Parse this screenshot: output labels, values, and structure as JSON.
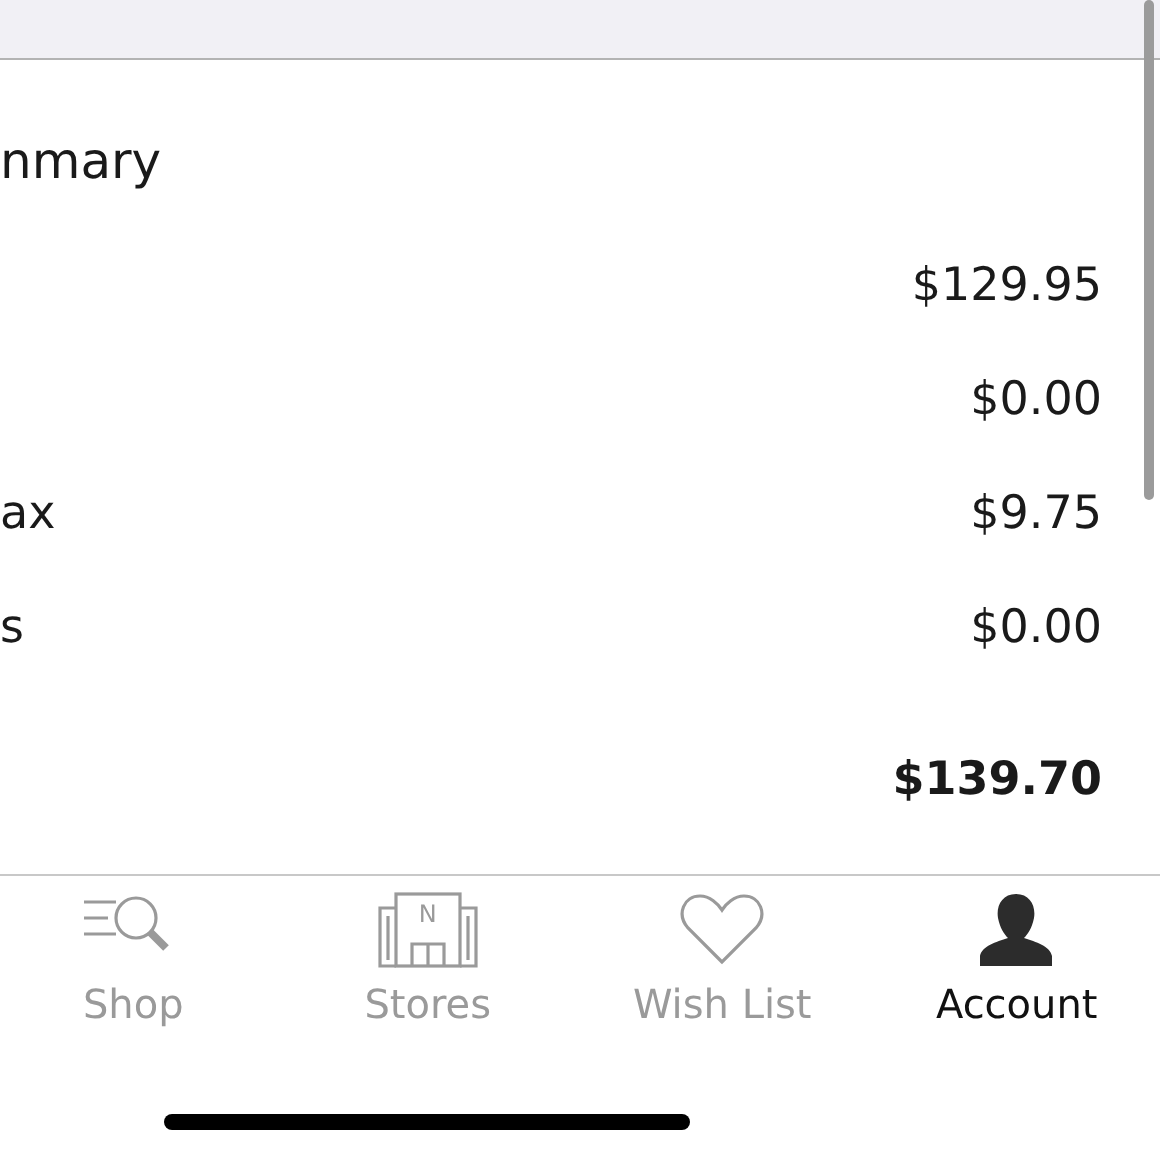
{
  "summary": {
    "title": "nmary",
    "rows": [
      {
        "label": "",
        "value": "$129.95",
        "bold": false
      },
      {
        "label": "",
        "value": "$0.00",
        "bold": false
      },
      {
        "label": "ax",
        "value": "$9.75",
        "bold": false
      },
      {
        "label": "s",
        "value": "$0.00",
        "bold": false
      },
      {
        "label": "",
        "value": "$139.70",
        "bold": true
      }
    ]
  },
  "tab_bar": [
    {
      "kind": "shop",
      "label": "Shop",
      "selected": false
    },
    {
      "kind": "stores",
      "label": "Stores",
      "icon_text": "N",
      "selected": false
    },
    {
      "kind": "wishlist",
      "label": "Wish List",
      "selected": false
    },
    {
      "kind": "account",
      "label": "Account",
      "selected": true
    }
  ]
}
